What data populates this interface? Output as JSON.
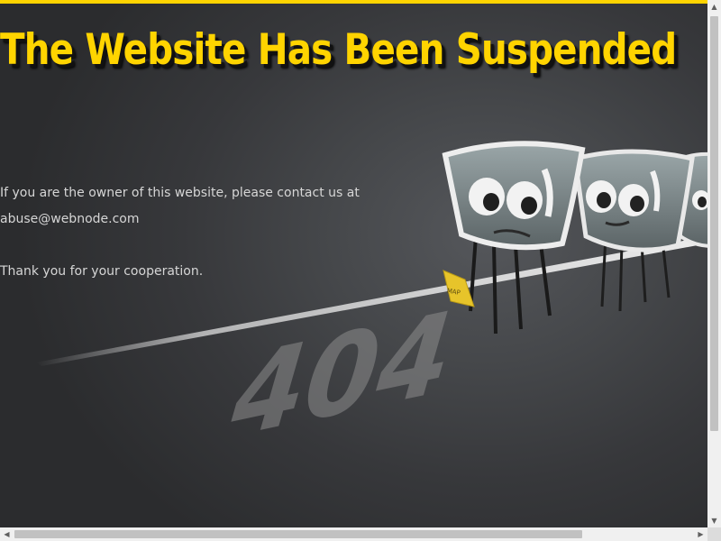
{
  "page": {
    "headline": "The Website Has Been Suspended",
    "message_line1": "If you are the owner of this website, please contact us at",
    "message_email": "abuse@webnode.com",
    "message_thanks": "Thank you for your cooperation."
  },
  "illustration": {
    "sign_text": "MAP",
    "road_number": "404"
  },
  "colors": {
    "accent": "#ffd400",
    "background": "#2e2f31",
    "text": "#d6d6d6"
  },
  "icons": {
    "scroll_up": "▲",
    "scroll_down": "▼",
    "scroll_left": "◀",
    "scroll_right": "▶"
  }
}
